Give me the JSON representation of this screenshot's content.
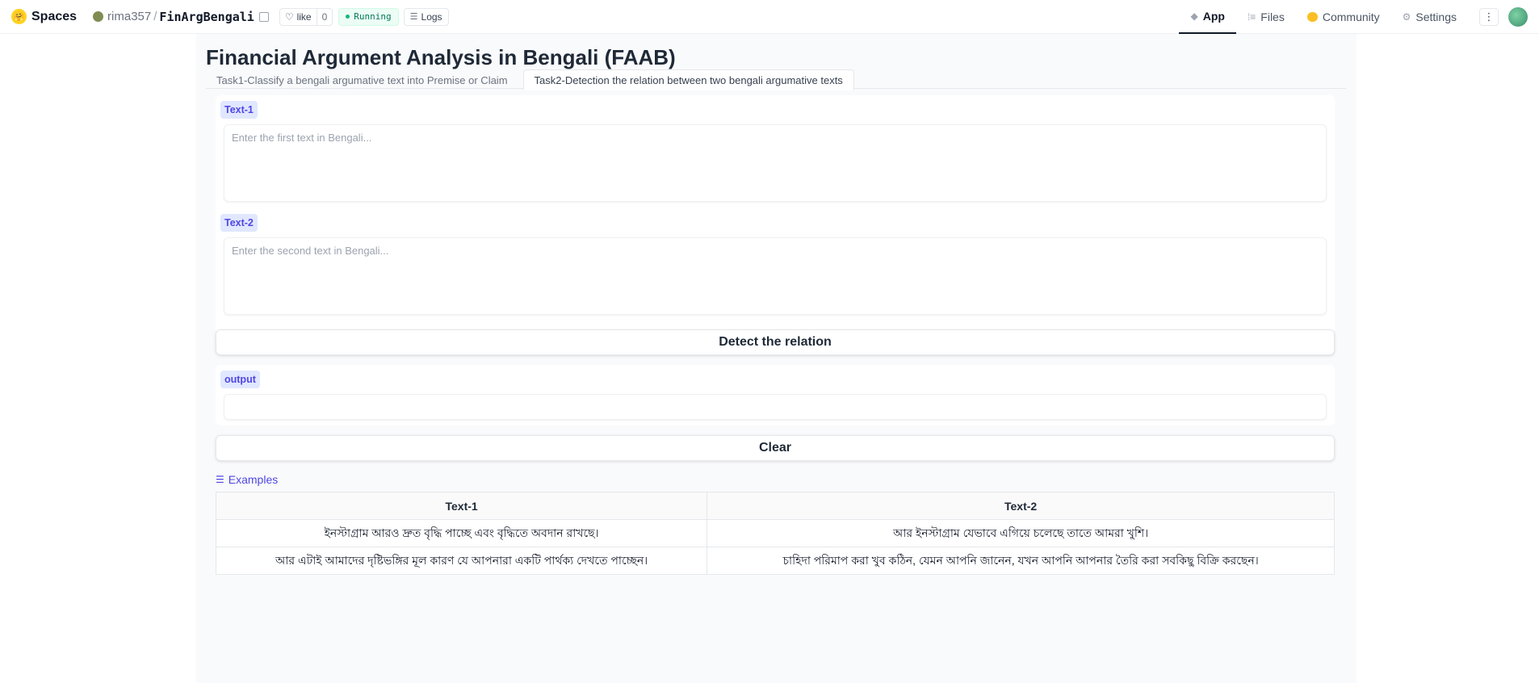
{
  "header": {
    "brand": "Spaces",
    "owner": "rima357",
    "space_name": "FinArgBengali",
    "like_label": "like",
    "like_count": "0",
    "status": "Running",
    "logs_label": "Logs",
    "nav": {
      "app": "App",
      "files": "Files",
      "community": "Community",
      "settings": "Settings"
    }
  },
  "page": {
    "title": "Financial Argument Analysis in Bengali (FAAB)",
    "tabs": [
      {
        "label": "Task1-Classify a bengali argumative text into Premise or Claim"
      },
      {
        "label": "Task2-Detection the relation between two bengali argumative texts"
      }
    ]
  },
  "form": {
    "text1_label": "Text-1",
    "text1_placeholder": "Enter the first text in Bengali...",
    "text2_label": "Text-2",
    "text2_placeholder": "Enter the second text in Bengali...",
    "submit_label": "Detect the relation",
    "output_label": "output",
    "output_value": "",
    "clear_label": "Clear"
  },
  "examples": {
    "label": "Examples",
    "headers": [
      "Text-1",
      "Text-2"
    ],
    "rows": [
      [
        "ইনস্টাগ্রাম আরও দ্রুত বৃদ্ধি পাচ্ছে এবং বৃদ্ধিতে অবদান রাখছে।",
        "আর ইনস্টাগ্রাম যেভাবে এগিয়ে চলেছে তাতে আমরা খুশি।"
      ],
      [
        "আর এটাই আমাদের দৃষ্টিভঙ্গির মূল কারণ যে আপনারা একটি পার্থক্য দেখতে পাচ্ছেন।",
        "চাহিদা পরিমাপ করা খুব কঠিন, যেমন আপনি জানেন, যখন আপনি আপনার তৈরি করা সবকিছু বিক্রি করছেন।"
      ]
    ]
  }
}
